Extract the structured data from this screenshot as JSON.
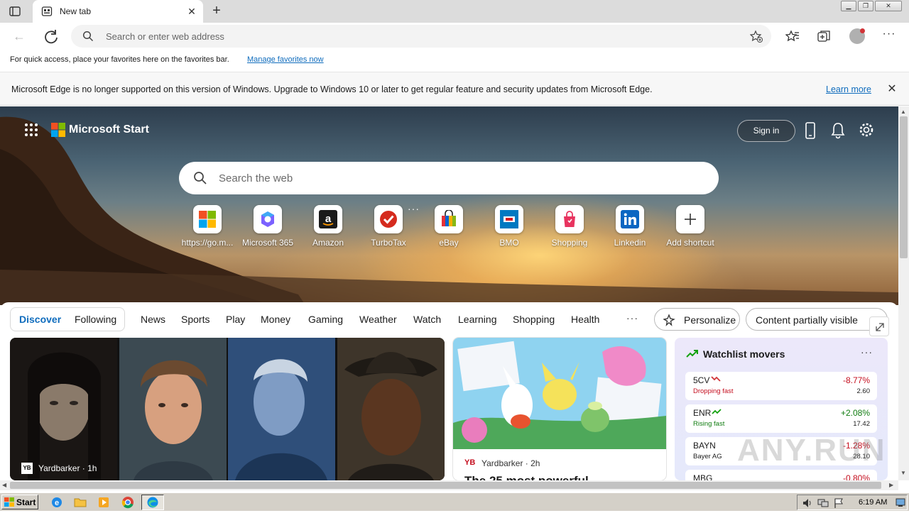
{
  "browser": {
    "tab_title": "New tab",
    "address_placeholder": "Search or enter web address",
    "favorites_hint": "For quick access, place your favorites here on the favorites bar.",
    "favorites_link": "Manage favorites now",
    "infobar_text": "Microsoft Edge is no longer supported on this version of Windows. Upgrade to Windows 10 or later to get regular feature and security updates from Microsoft Edge.",
    "infobar_link": "Learn more"
  },
  "start": {
    "brand": "Microsoft Start",
    "sign_in": "Sign in",
    "search_placeholder": "Search the web",
    "shortcuts": [
      {
        "label": "https://go.m...",
        "icon": "windows-logo-icon"
      },
      {
        "label": "Microsoft 365",
        "icon": "microsoft-365-icon"
      },
      {
        "label": "Amazon",
        "icon": "amazon-icon"
      },
      {
        "label": "TurboTax",
        "icon": "turbotax-icon"
      },
      {
        "label": "eBay",
        "icon": "ebay-bag-icon"
      },
      {
        "label": "BMO",
        "icon": "bmo-icon"
      },
      {
        "label": "Shopping",
        "icon": "shopping-bag-icon"
      },
      {
        "label": "Linkedin",
        "icon": "linkedin-icon"
      },
      {
        "label": "Add shortcut",
        "icon": "plus-icon"
      }
    ]
  },
  "feed": {
    "toggle": {
      "discover": "Discover",
      "following": "Following"
    },
    "tabs": [
      "News",
      "Sports",
      "Play",
      "Money",
      "Gaming",
      "Weather",
      "Watch",
      "Learning",
      "Shopping",
      "Health"
    ],
    "personalize": "Personalize",
    "content_select": "Content partially visible",
    "cards": {
      "big": {
        "source": "Yardbarker · 1h"
      },
      "pokemon": {
        "source_logo": "YB",
        "source": "Yardbarker · 2h",
        "headline": "The 25 most powerful"
      }
    },
    "watchlist": {
      "title": "Watchlist movers",
      "stocks": [
        {
          "symbol": "5CV",
          "sub": "Dropping fast",
          "change": "-8.77%",
          "price": "2.60",
          "direction": "down"
        },
        {
          "symbol": "ENR",
          "sub": "Rising fast",
          "change": "+2.08%",
          "price": "17.42",
          "direction": "up"
        },
        {
          "symbol": "BAYN",
          "sub": "Bayer AG",
          "change": "-1.28%",
          "price": "28.10",
          "direction": "down"
        },
        {
          "symbol": "MBG",
          "sub": "",
          "change": "-0.80%",
          "price": "",
          "direction": "down"
        }
      ]
    }
  },
  "colors": {
    "accent": "#0f6cbd",
    "down": "#c50f1f",
    "up": "#107c10"
  },
  "watermark": "ANY.RUN",
  "taskbar": {
    "start": "Start",
    "clock": "6:19 AM"
  }
}
